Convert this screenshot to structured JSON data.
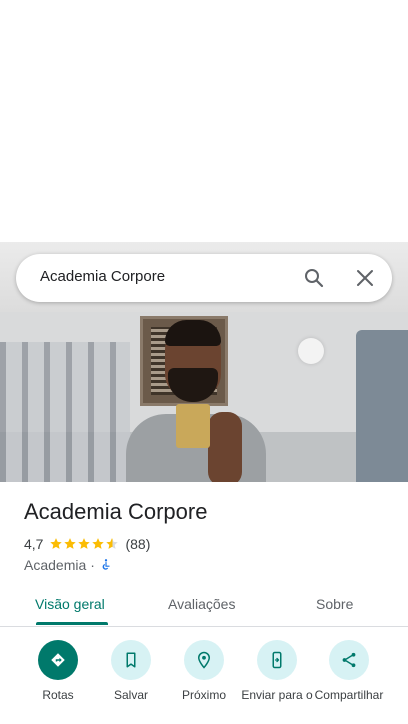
{
  "search": {
    "query": "Academia Corpore"
  },
  "place": {
    "name": "Academia Corpore",
    "rating": "4,7",
    "rating_value": 4.7,
    "review_count": "(88)",
    "category": "Academia",
    "separator": "·"
  },
  "tabs": [
    {
      "label": "Visão geral",
      "active": true
    },
    {
      "label": "Avaliações",
      "active": false
    },
    {
      "label": "Sobre",
      "active": false
    }
  ],
  "actions": [
    {
      "label": "Rotas",
      "icon": "directions-icon"
    },
    {
      "label": "Salvar",
      "icon": "bookmark-icon"
    },
    {
      "label": "Próximo",
      "icon": "nearby-icon"
    },
    {
      "label": "Enviar para o",
      "icon": "send-to-phone-icon"
    },
    {
      "label": "Compartilhar",
      "icon": "share-icon"
    }
  ],
  "colors": {
    "accent": "#00796b",
    "action_bg": "#d7f2f4",
    "star": "#fbbc04"
  }
}
